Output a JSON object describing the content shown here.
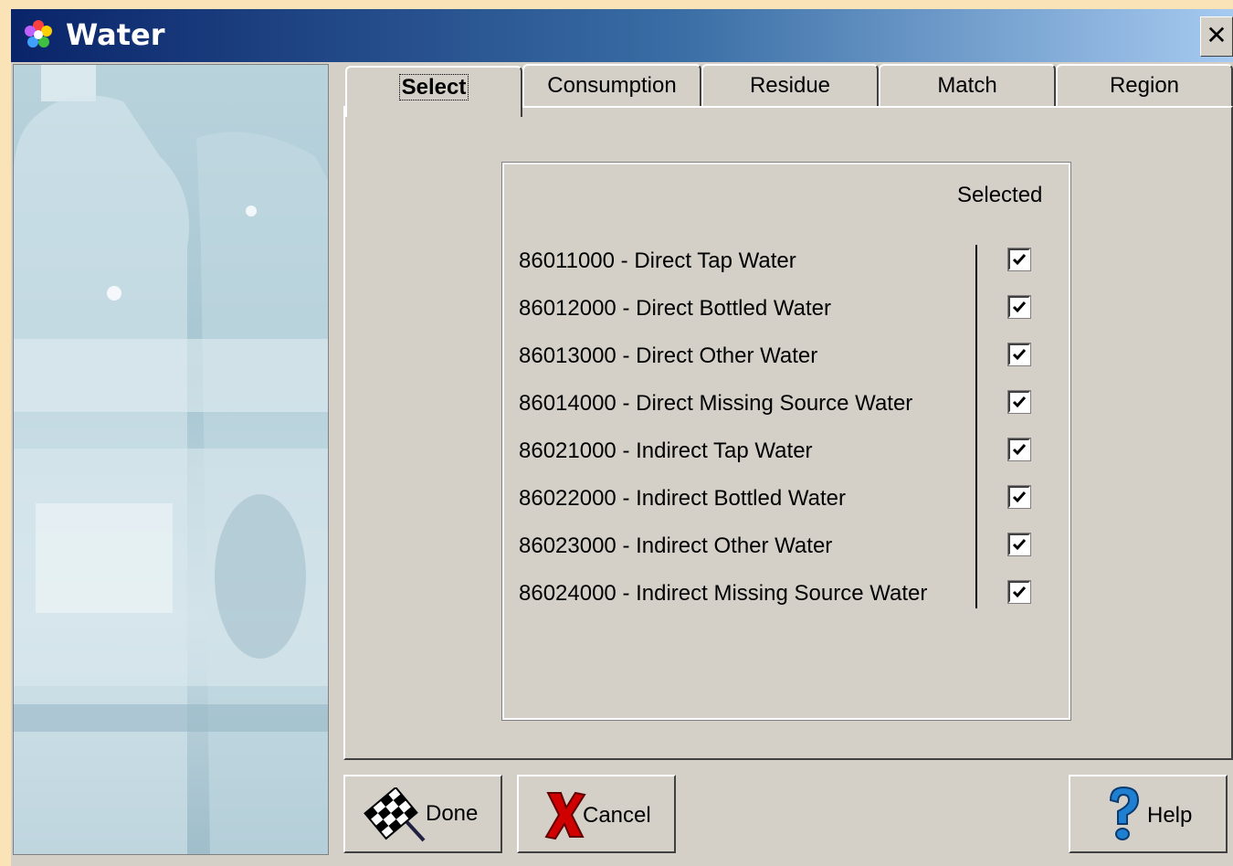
{
  "window": {
    "title": "Water",
    "close_glyph": "✕"
  },
  "tabs": [
    {
      "label": "Select",
      "active": true
    },
    {
      "label": "Consumption",
      "active": false
    },
    {
      "label": "Residue",
      "active": false
    },
    {
      "label": "Match",
      "active": false
    },
    {
      "label": "Region",
      "active": false
    }
  ],
  "select": {
    "column_header": "Selected",
    "items": [
      {
        "label": "86011000 - Direct Tap Water",
        "checked": true
      },
      {
        "label": "86012000 - Direct Bottled Water",
        "checked": true
      },
      {
        "label": "86013000 - Direct Other Water",
        "checked": true
      },
      {
        "label": "86014000 - Direct Missing Source Water",
        "checked": true
      },
      {
        "label": "86021000 - Indirect Tap Water",
        "checked": true
      },
      {
        "label": "86022000 - Indirect Bottled Water",
        "checked": true
      },
      {
        "label": "86023000 - Indirect Other Water",
        "checked": true
      },
      {
        "label": "86024000 - Indirect Missing Source Water",
        "checked": true
      }
    ]
  },
  "buttons": {
    "done": {
      "label": "Done",
      "icon": "checkered-flag-icon"
    },
    "cancel": {
      "label": "Cancel",
      "icon": "red-x-icon"
    },
    "help": {
      "label": "Help",
      "icon": "question-mark-icon"
    }
  },
  "colors": {
    "title_gradient_start": "#0a246a",
    "title_gradient_end": "#a6caf0",
    "dialog_face": "#d4d0c8",
    "desktop": "#fbe3b8"
  }
}
